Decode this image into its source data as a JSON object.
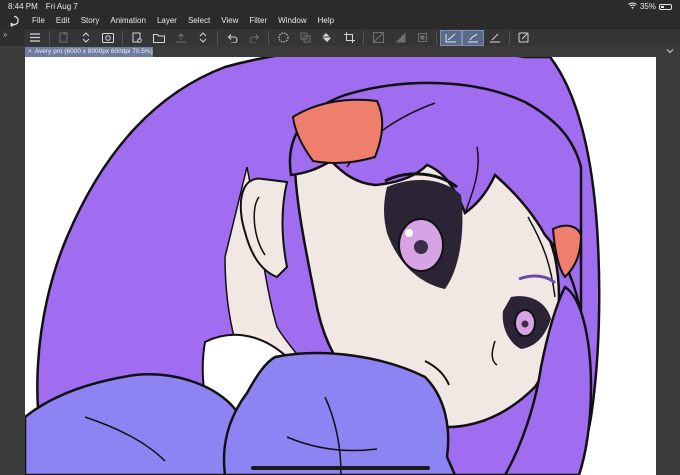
{
  "status_bar": {
    "time": "8:44 PM",
    "date": "Fri Aug 7",
    "battery_percent": "35%",
    "battery_level": 0.35,
    "wifi_icon": "wifi-icon"
  },
  "menu": {
    "app_icon": "clip-studio-icon",
    "items": [
      "File",
      "Edit",
      "Story",
      "Animation",
      "Layer",
      "Select",
      "View",
      "Filter",
      "Window",
      "Help"
    ]
  },
  "toolbar": {
    "side_toggle": "»",
    "icons": [
      "menu-icon",
      "new-icon",
      "stepper-icon",
      "camera-icon",
      "page-icon",
      "open-folder-icon",
      "upload-icon",
      "upload-stepper-icon",
      "undo-icon",
      "redo-icon",
      "selection-icon",
      "copy-icon",
      "fill-icon",
      "crop-icon",
      "clear-icon",
      "invert-icon",
      "transform-icon",
      "ruler-icon",
      "snap-icon",
      "pen-icon",
      "settings-icon"
    ]
  },
  "document": {
    "tab_title": "Avery pro (6000 x 8000px 600dpi 70.5%)",
    "close_symbol": "×"
  },
  "colors": {
    "hair": "#a06cf0",
    "hair_line": "#111111",
    "skin": "#f1e7e3",
    "clip": "#ef7e6c",
    "hoodie": "#8e83f2",
    "eye_iris": "#d6a3e4",
    "collar": "#ffffff"
  }
}
